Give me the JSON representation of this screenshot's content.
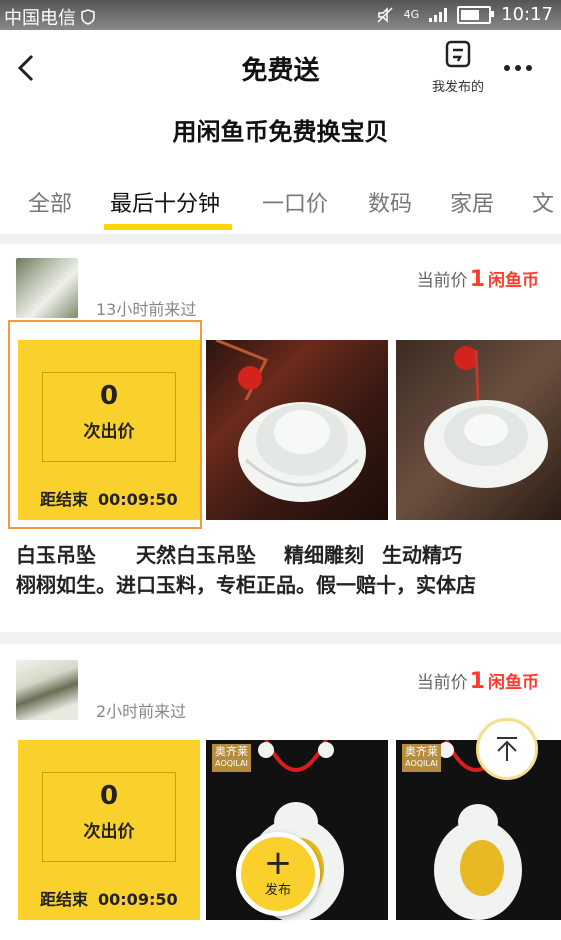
{
  "status": {
    "carrier": "中国电信",
    "network": "4G",
    "time": "10:17"
  },
  "header": {
    "title": "免费送",
    "my_posts_label": "我发布的"
  },
  "subtitle": "用闲鱼币免费换宝贝",
  "tabs": [
    "全部",
    "最后十分钟",
    "一口价",
    "数码",
    "家居",
    "文"
  ],
  "active_tab": 1,
  "cards": [
    {
      "visited": "13小时前来过",
      "price_prefix": "当前价",
      "price_value": "1",
      "price_unit": "闲鱼币",
      "bid_count": "0",
      "bid_label": "次出价",
      "countdown_label": "距结束",
      "countdown_time": "00:09:50",
      "desc_line1": [
        "白玉吊坠",
        "天然白玉吊坠",
        "精细雕刻",
        "生动精巧"
      ],
      "desc_line2": "栩栩如生。进口玉料，专柜正品。假一赔十，实体店"
    },
    {
      "visited": "2小时前来过",
      "price_prefix": "当前价",
      "price_value": "1",
      "price_unit": "闲鱼币",
      "bid_count": "0",
      "bid_label": "次出价",
      "countdown_label": "距结束",
      "countdown_time": "00:09:50",
      "brand_text_cn": "奥齐莱",
      "brand_text_en": "AOQILAI"
    }
  ],
  "fab_label": "发布",
  "colors": {
    "accent": "#fad12c",
    "price": "#ff3b2f",
    "highlight": "#f59a3c"
  }
}
